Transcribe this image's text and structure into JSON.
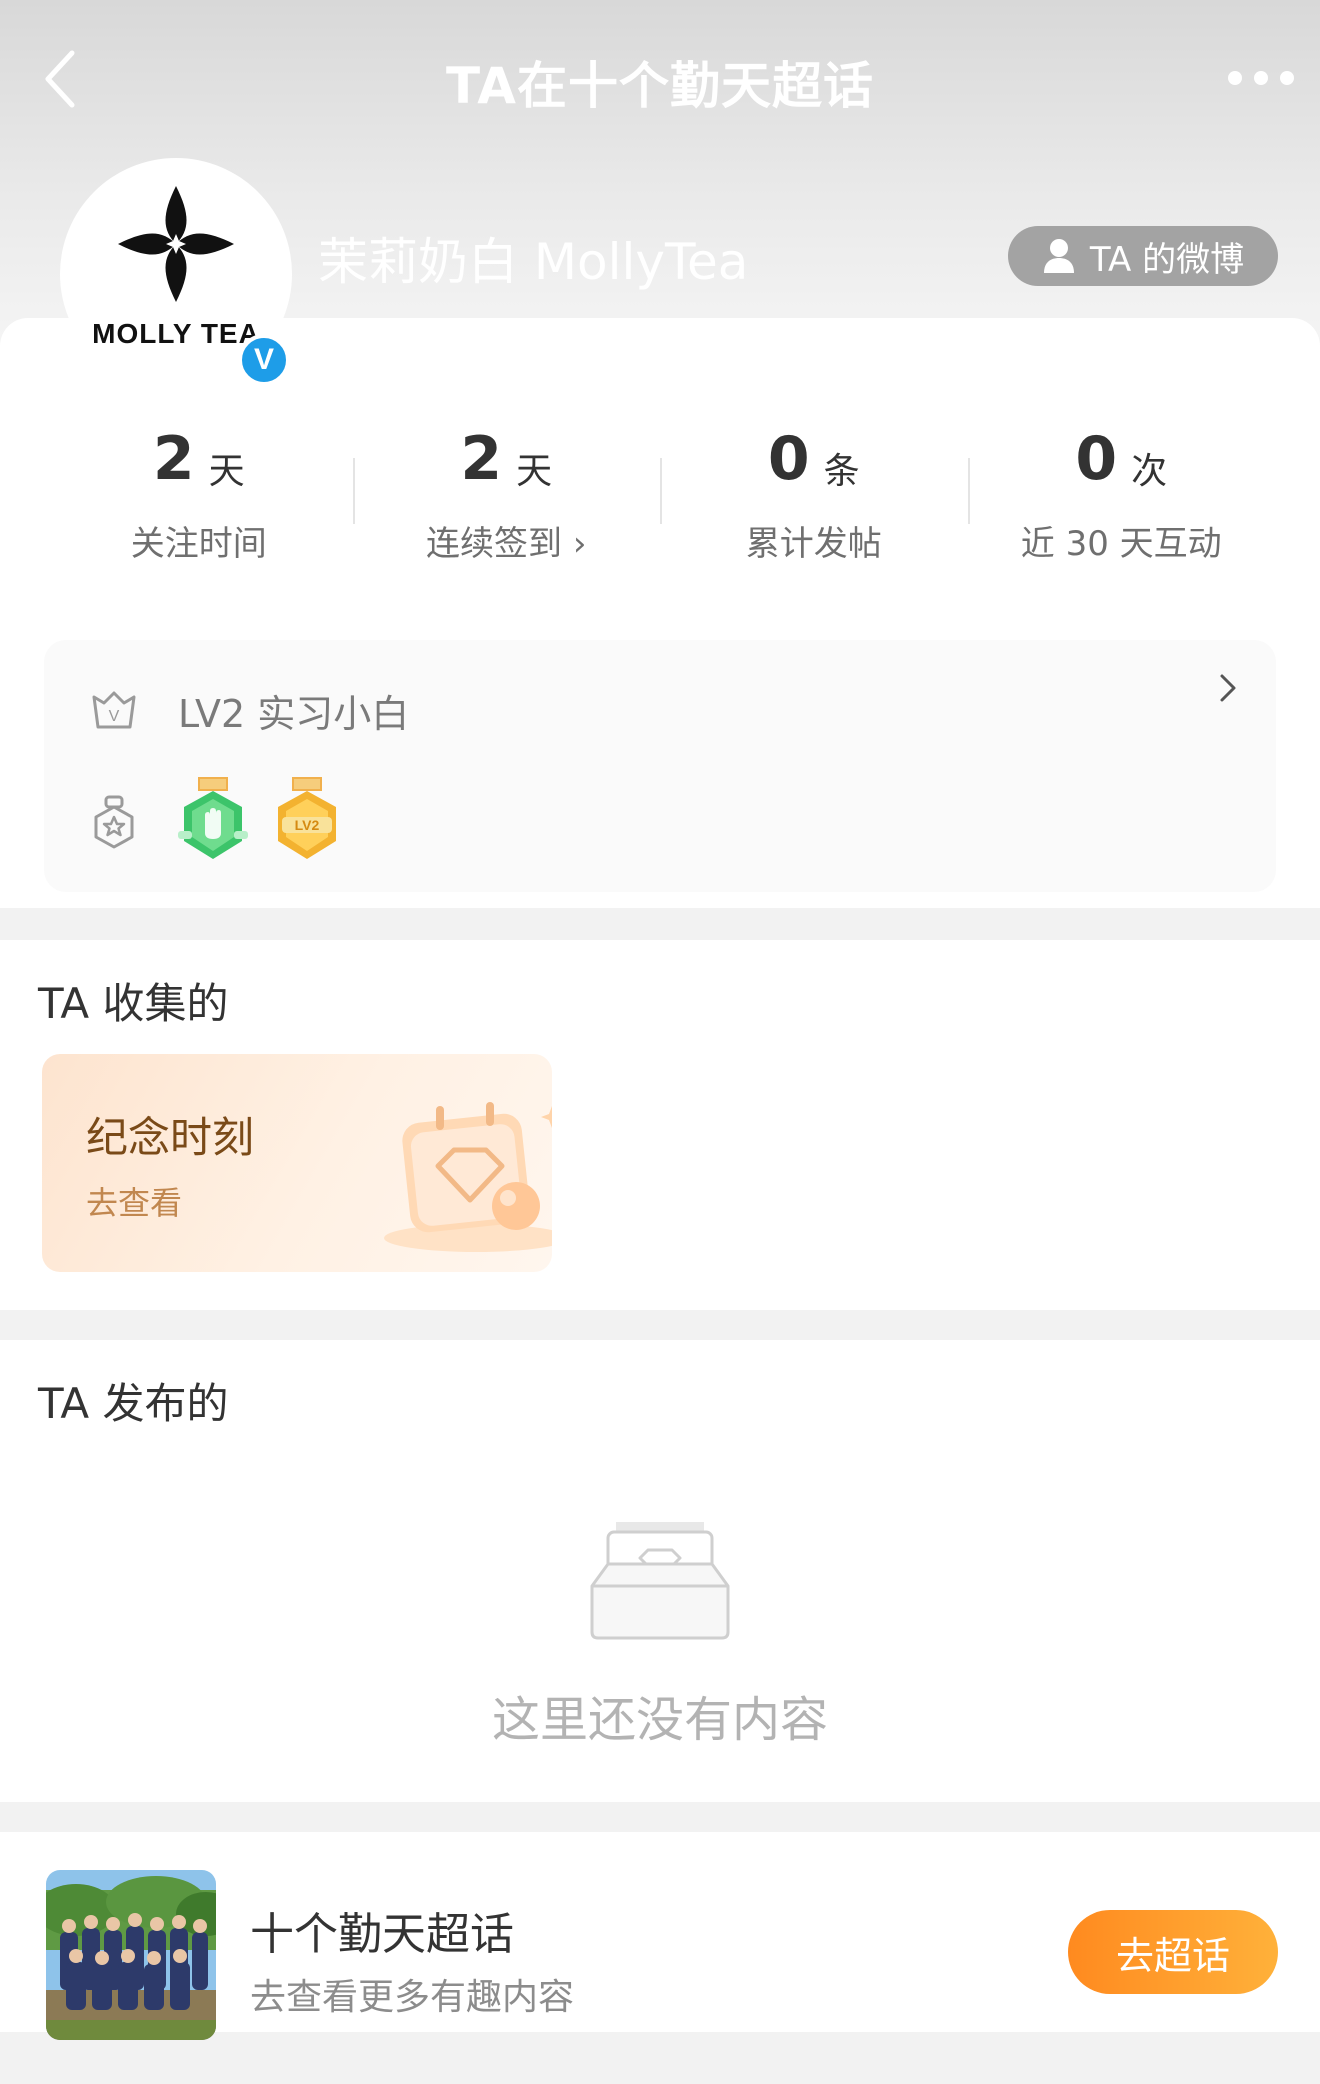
{
  "nav": {
    "title": "TA在十个勤天超话"
  },
  "profile": {
    "avatar_logo_text": "MOLLY TEA",
    "verified_mark": "V",
    "username": "茉莉奶白 MollyTea",
    "weibo_button": "TA 的微博"
  },
  "stats": [
    {
      "value": "2",
      "unit": "天",
      "label": "关注时间"
    },
    {
      "value": "2",
      "unit": "天",
      "label": "连续签到 ›"
    },
    {
      "value": "0",
      "unit": "条",
      "label": "累计发帖"
    },
    {
      "value": "0",
      "unit": "次",
      "label": "近 30 天互动"
    }
  ],
  "level": {
    "text": "LV2 实习小白",
    "medals": [
      "hand-medal-icon",
      "lv2-medal-icon"
    ],
    "lv2_medal_text": "LV2"
  },
  "collected": {
    "title": "TA 收集的",
    "card_title": "纪念时刻",
    "card_sub": "去查看"
  },
  "posted": {
    "title": "TA 发布的",
    "empty_text": "这里还没有内容"
  },
  "footer": {
    "topic_name": "十个勤天超话",
    "topic_sub": "去查看更多有趣内容",
    "goto_button": "去超话"
  },
  "colors": {
    "accent_orange": "#ff8a1f",
    "verified_blue": "#1e9de8",
    "memory_text": "#7a4a18"
  }
}
